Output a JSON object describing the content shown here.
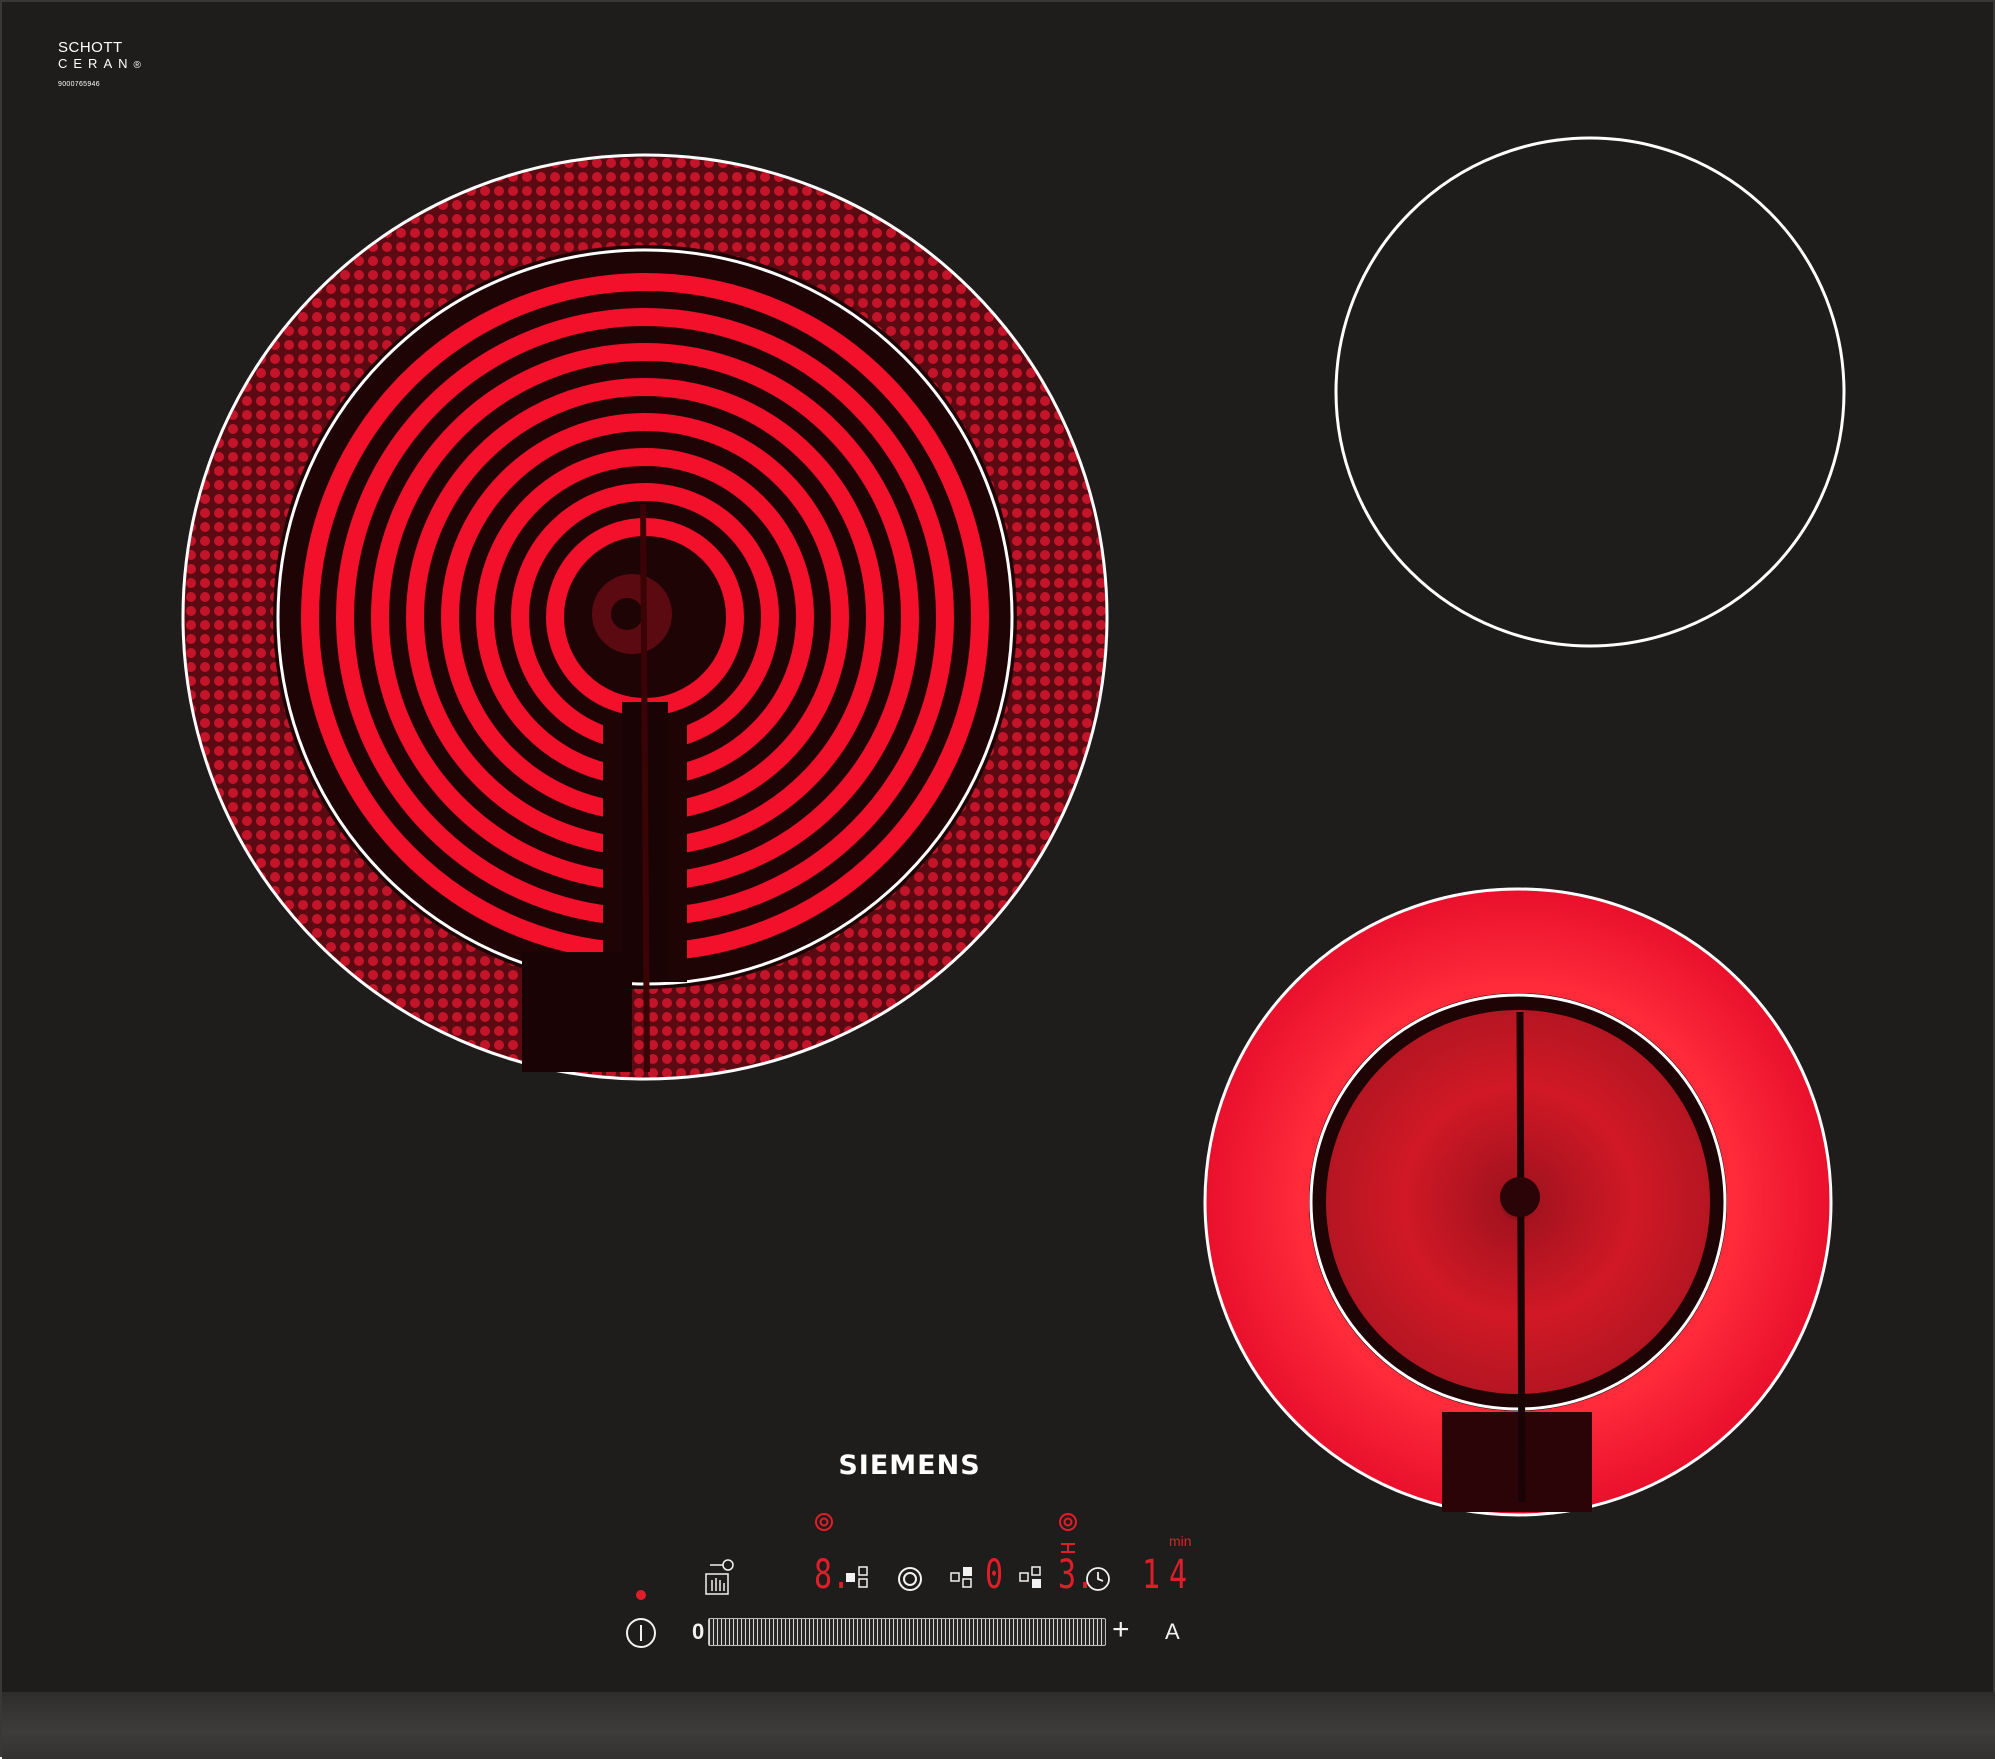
{
  "logo": {
    "line1": "SCHOTT",
    "line2": "CERAN",
    "registered": "®",
    "serial": "9000765946"
  },
  "brand": "SIEMENS",
  "zones": {
    "front_left": {
      "state": "on",
      "rings": "dual"
    },
    "rear_right": {
      "state": "off"
    },
    "front_right": {
      "state": "on",
      "rings": "dual"
    }
  },
  "controls": {
    "power_icon": "power-icon",
    "lock_icon": "child-lock-icon",
    "zone1_level": "8.",
    "zone2_level": "0",
    "zone3_level": "3.",
    "dual_ring_icon": "dual-ring-icon",
    "center_zone_icon": "ring-icon",
    "timer_icon": "clock-icon",
    "timer_value": "14",
    "timer_unit": "min",
    "slider_min": "0",
    "slider_max": "+",
    "auto_label": "A"
  },
  "colors": {
    "glass": "#1f1d1b",
    "heat_red": "#e8102c",
    "display_red": "#e01e2a",
    "marking": "#ffffff"
  }
}
